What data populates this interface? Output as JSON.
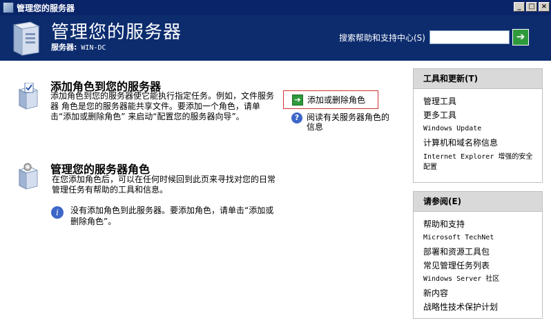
{
  "window": {
    "title": "管理您的服务器",
    "buttons": {
      "minimize": "_",
      "restore": "□",
      "close": "×"
    }
  },
  "header": {
    "title": "管理您的服务器",
    "server_label": "服务器:",
    "server_name": "WIN-DC",
    "search_label": "搜索帮助和支持中心(S)",
    "search_value": "",
    "go_icon": "arrow-right-icon"
  },
  "section_add": {
    "title": "添加角色到您的服务器",
    "desc": "添加角色到您的服务器使它能执行指定任务。例如，文件服务器 角色是您的服务器能共享文件。要添加一个角色，请单击“添加或删除角色” 来启动“配置您的服务器向导”。",
    "add_remove_link": "添加或删除角色",
    "read_more_link": "阅读有关服务器角色的信息"
  },
  "section_manage": {
    "title": "管理您的服务器角色",
    "desc": "在您添加角色后，可以在任何时候回到此页来寻找对您的日常管理任务有帮助的工具和信息。",
    "info": "没有添加角色到此服务器。要添加角色，请单击“添加或删除角色”。"
  },
  "tools_panel": {
    "title": "工具和更新(T)",
    "items": [
      "管理工具",
      "更多工具",
      "Windows Update",
      "计算机和域名称信息",
      "Internet Explorer 增强的安全配置"
    ]
  },
  "see_also_panel": {
    "title": "请参阅(E)",
    "items": [
      "帮助和支持",
      "Microsoft TechNet",
      "部署和资源工具包",
      "常见管理任务列表",
      "Windows Server 社区",
      "新内容",
      "战略性技术保护计划"
    ]
  }
}
